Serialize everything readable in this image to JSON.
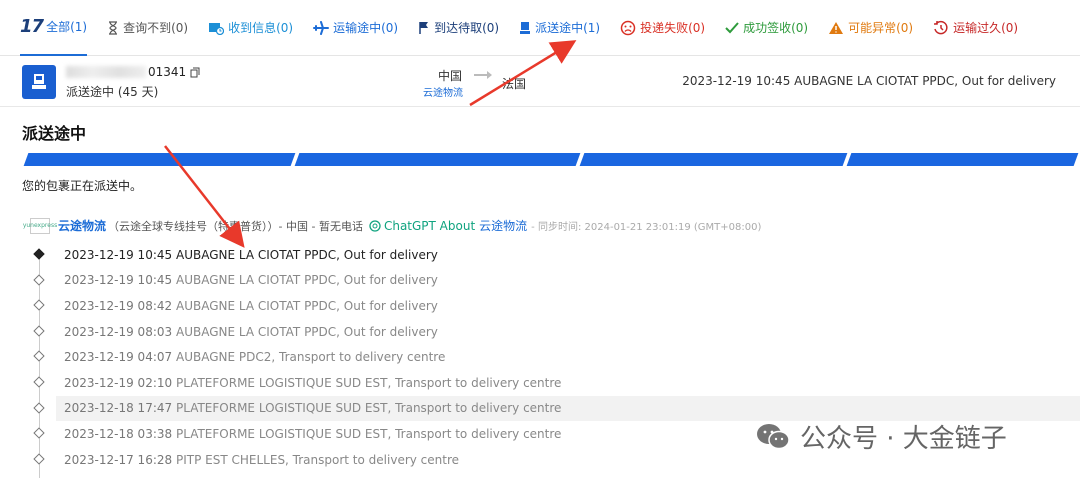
{
  "tabs": [
    {
      "id": "all",
      "label": "全部(1)",
      "color": "#1c6cd6",
      "icon": "logo-17-icon",
      "active": true
    },
    {
      "id": "notfound",
      "label": "查询不到(0)",
      "color": "#555555",
      "icon": "hourglass-icon"
    },
    {
      "id": "inforeceived",
      "label": "收到信息(0)",
      "color": "#1c8fd6",
      "icon": "info-received-icon"
    },
    {
      "id": "intransit",
      "label": "运输途中(0)",
      "color": "#1c6cd6",
      "icon": "airplane-icon"
    },
    {
      "id": "pickup",
      "label": "到达待取(0)",
      "color": "#1c3f7a",
      "icon": "flag-icon"
    },
    {
      "id": "outfordelivery",
      "label": "派送途中(1)",
      "color": "#1c6cd6",
      "icon": "courier-icon"
    },
    {
      "id": "failed",
      "label": "投递失败(0)",
      "color": "#d93025",
      "icon": "sad-face-icon"
    },
    {
      "id": "delivered",
      "label": "成功签收(0)",
      "color": "#2e9b3c",
      "icon": "check-icon"
    },
    {
      "id": "exception",
      "label": "可能异常(0)",
      "color": "#e07a10",
      "icon": "warning-icon"
    },
    {
      "id": "expired",
      "label": "运输过久(0)",
      "color": "#c62828",
      "icon": "clock-history-icon"
    }
  ],
  "summary": {
    "tracking_suffix": "01341",
    "status_days": "派送途中 (45 天)",
    "origin": "中国",
    "origin_carrier": "云途物流",
    "destination": "法国",
    "latest_event": "2023-12-19 10:45 AUBAGNE LA CIOTAT PPDC, Out for delivery"
  },
  "status": {
    "title": "派送途中",
    "description": "您的包裹正在派送中。"
  },
  "carrier": {
    "logo_text": "yunexpress",
    "name": "云途物流",
    "detail": "（云途全球专线挂号（特惠普货））- 中国 - 暂无电话",
    "gpt_label": "ChatGPT About",
    "gpt_carrier": "云途物流",
    "sync": "- 同步时间: 2024-01-21 23:01:19 (GMT+08:00)"
  },
  "events": [
    {
      "time": "2023-12-19 10:45",
      "desc": "AUBAGNE LA CIOTAT PPDC, Out for delivery"
    },
    {
      "time": "2023-12-19 10:45",
      "desc": "AUBAGNE LA CIOTAT PPDC, Out for delivery"
    },
    {
      "time": "2023-12-19 08:42",
      "desc": "AUBAGNE LA CIOTAT PPDC, Out for delivery"
    },
    {
      "time": "2023-12-19 08:03",
      "desc": "AUBAGNE LA CIOTAT PPDC, Out for delivery"
    },
    {
      "time": "2023-12-19 04:07",
      "desc": "AUBAGNE PDC2, Transport to delivery centre"
    },
    {
      "time": "2023-12-19 02:10",
      "desc": "PLATEFORME LOGISTIQUE SUD EST, Transport to delivery centre"
    },
    {
      "time": "2023-12-18 17:47",
      "desc": "PLATEFORME LOGISTIQUE SUD EST, Transport to delivery centre"
    },
    {
      "time": "2023-12-18 03:38",
      "desc": "PLATEFORME LOGISTIQUE SUD EST, Transport to delivery centre"
    },
    {
      "time": "2023-12-17 16:28",
      "desc": "PITP EST CHELLES, Transport to delivery centre"
    }
  ],
  "watermark": {
    "text": "公众号 · 大金链子"
  },
  "colors": {
    "accent": "#1a66e0",
    "annotation_arrow": "#e8392b"
  }
}
